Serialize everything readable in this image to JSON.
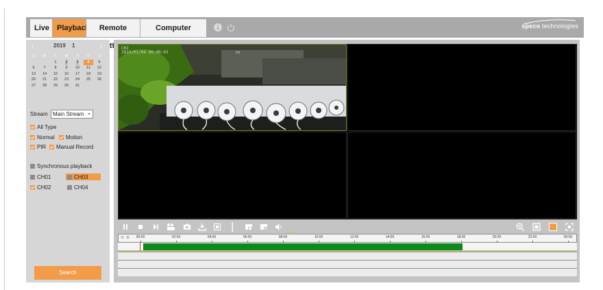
{
  "nav": {
    "tabs": [
      {
        "label": "Live",
        "active": false
      },
      {
        "label": "Playback",
        "active": true
      },
      {
        "label": "Remote Setting",
        "active": false
      },
      {
        "label": "Computer Settings",
        "active": false
      }
    ],
    "icons": [
      "info-icon",
      "power-icon"
    ],
    "brand_bold": "speco",
    "brand_light": " technologies"
  },
  "calendar": {
    "year": "2019",
    "month": "1",
    "prev_icon": "chevron-left-icon",
    "next_icon": "chevron-right-icon",
    "weekdays": [
      "S",
      "M",
      "T",
      "W",
      "T",
      "F",
      "S"
    ],
    "weeks": [
      [
        "",
        "",
        "1",
        "2",
        "3",
        "4",
        "5"
      ],
      [
        "6",
        "7",
        "8",
        "9",
        "10",
        "11",
        "12"
      ],
      [
        "13",
        "14",
        "15",
        "16",
        "17",
        "18",
        "19"
      ],
      [
        "20",
        "21",
        "22",
        "23",
        "24",
        "25",
        "26"
      ],
      [
        "27",
        "28",
        "29",
        "30",
        "31",
        "",
        ""
      ]
    ],
    "recorded_days": [
      "2",
      "3",
      "4"
    ],
    "selected_day": "4"
  },
  "stream": {
    "label": "Stream",
    "value": "Main Stream"
  },
  "record_types": {
    "all": {
      "label": "All Type",
      "checked": true
    },
    "normal": {
      "label": "Normal",
      "checked": true
    },
    "motion": {
      "label": "Motion",
      "checked": true
    },
    "pir": {
      "label": "PIR",
      "checked": true
    },
    "manual": {
      "label": "Manual Record",
      "checked": true
    }
  },
  "sync": {
    "label": "Synchronous playback",
    "checked": false
  },
  "channels": [
    {
      "label": "CH01",
      "checked": false
    },
    {
      "label": "CH03",
      "checked": false,
      "highlighted": true
    },
    {
      "label": "CH02",
      "checked": true
    },
    {
      "label": "CH04",
      "checked": false
    }
  ],
  "search_label": "Search",
  "video": {
    "active_cell": 0,
    "osd_channel": "CH2",
    "osd_datetime": "2019/01/04 00:00:03",
    "osd_extra": "5d"
  },
  "controls": {
    "left": [
      "pause-icon",
      "stop-icon",
      "step-forward-icon",
      "camera-fps-icon",
      "snapshot-icon",
      "download-icon",
      "clip-icon",
      "folder-icon",
      "save-icon",
      "volume-icon"
    ],
    "right": [
      "zoom-in-icon",
      "layout-1-icon",
      "layout-4-icon",
      "fullscreen-icon"
    ],
    "colors": {
      "icon": "#ffffff",
      "active": "#f29b49"
    }
  },
  "timeline": {
    "hours": [
      "00:00",
      "02:00",
      "04:00",
      "06:00",
      "08:00",
      "10:00",
      "12:00",
      "14:00",
      "16:00",
      "18:00",
      "20:00",
      "22:00",
      "00:00"
    ],
    "current_time": "08:00",
    "recording_start_hour": 0.2,
    "recording_end_hour": 18.1,
    "colors": {
      "recording": "#0e8a1c",
      "cursor": "#e03a2e"
    }
  },
  "colors": {
    "accent": "#f29b49",
    "topbar": "#a9a9a9",
    "sidebar": "#d6d6d6"
  }
}
